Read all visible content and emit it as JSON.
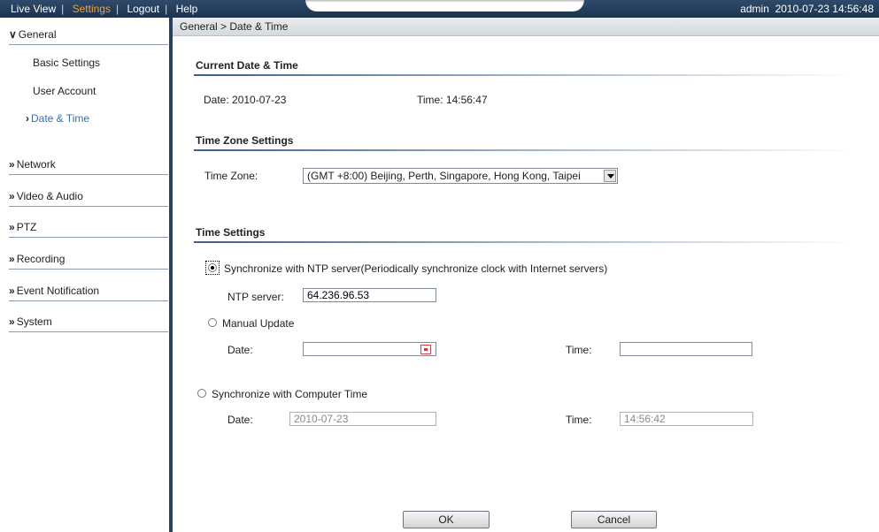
{
  "topbar": {
    "nav": [
      "Live View",
      "Settings",
      "Logout",
      "Help"
    ],
    "user": "admin",
    "datetime": "2010-07-23 14:56:48"
  },
  "sidebar": {
    "general": "General",
    "general_items": [
      "Basic Settings",
      "User Account",
      "Date & Time"
    ],
    "sections": [
      "Network",
      "Video & Audio",
      "PTZ",
      "Recording",
      "Event Notification",
      "System"
    ]
  },
  "breadcrumb": "General > Date & Time",
  "current": {
    "heading": "Current Date & Time",
    "date_label": "Date:",
    "date_value": "2010-07-23",
    "time_label": "Time:",
    "time_value": "14:56:47"
  },
  "timezone": {
    "heading": "Time Zone Settings",
    "label": "Time Zone:",
    "selected": "(GMT +8:00) Beijing, Perth, Singapore, Hong Kong, Taipei"
  },
  "settings": {
    "heading": "Time Settings",
    "ntp_option": "Synchronize with NTP server(Periodically synchronize clock with Internet servers)",
    "ntp_server_label": "NTP server:",
    "ntp_server_value": "64.236.96.53",
    "manual_option": "Manual Update",
    "manual_date_label": "Date:",
    "manual_date_value": "",
    "manual_time_label": "Time:",
    "manual_time_value": "",
    "computer_option": "Synchronize with Computer Time",
    "computer_date_label": "Date:",
    "computer_date_value": "2010-07-23",
    "computer_time_label": "Time:",
    "computer_time_value": "14:56:42"
  },
  "buttons": {
    "ok": "OK",
    "cancel": "Cancel"
  }
}
